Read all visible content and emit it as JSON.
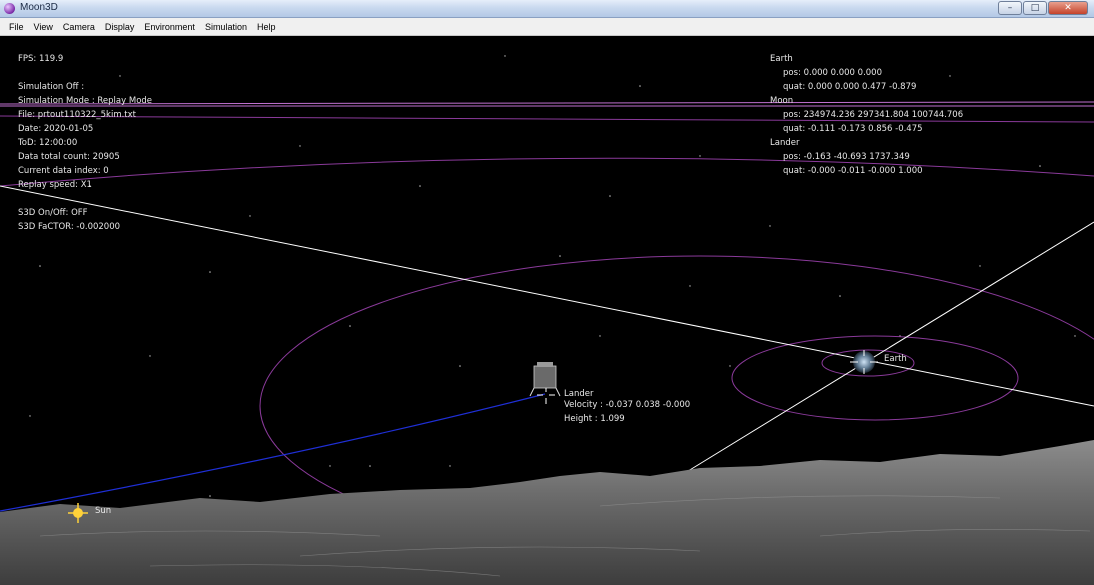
{
  "window": {
    "title": "Moon3D"
  },
  "menu": [
    "File",
    "View",
    "Camera",
    "Display",
    "Environment",
    "Simulation",
    "Help"
  ],
  "hud_left": {
    "fps": "FPS: 119.9",
    "simulation": "Simulation Off :",
    "mode": "Simulation Mode : Replay Mode",
    "file": "File: prtout110322_5kim.txt",
    "date": "Date: 2020-01-05",
    "tod": "ToD: 12:00:00",
    "total": "Data total count: 20905",
    "index": "Current data index: 0",
    "speed": "Replay speed: X1",
    "s3d": "S3D On/Off: OFF",
    "factor": "S3D FaCTOR: -0.002000"
  },
  "hud_right": {
    "earth_title": "Earth",
    "earth_pos": "pos: 0.000 0.000 0.000",
    "earth_quat": "quat: 0.000 0.000 0.477 -0.879",
    "moon_title": "Moon",
    "moon_pos": "pos: 234974.236 297341.804 100744.706",
    "moon_quat": "quat: -0.111 -0.173 0.856 -0.475",
    "lander_title": "Lander",
    "lander_pos": "pos: -0.163 -40.693 1737.349",
    "lander_quat": "quat: -0.000 -0.011 -0.000 1.000"
  },
  "scene": {
    "lander_name": "Lander",
    "lander_velocity": "Velocity : -0.037 0.038 -0.000",
    "lander_height": "Height : 1.099",
    "earth_label": "Earth",
    "sun_label": "Sun"
  },
  "colors": {
    "orbit": "#8a3a9a",
    "trajectory": "#1f2fd6",
    "line": "#ffffff",
    "sun": "#ffd23a"
  }
}
